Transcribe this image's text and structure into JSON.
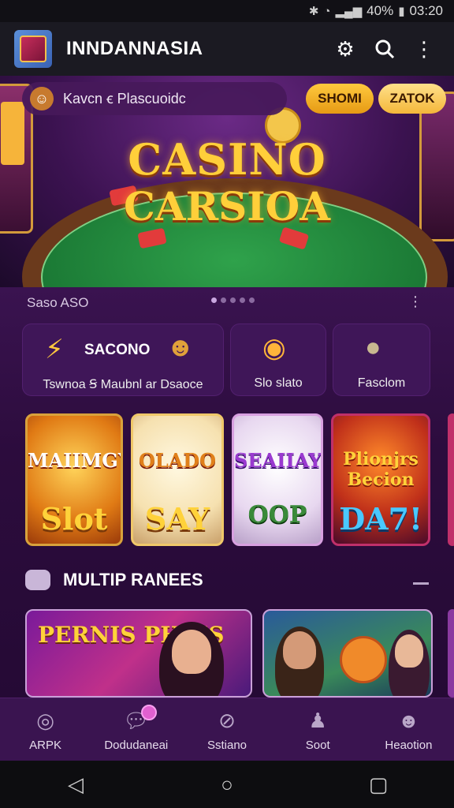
{
  "status_bar": {
    "battery": "40%",
    "time": "03:20"
  },
  "app_bar": {
    "title": "INNDANNASIA"
  },
  "hero": {
    "promo_text": "Kavcn ꞓ Plascuoidc",
    "pill_1": "SHOMI",
    "pill_2": "ZATOK",
    "title_1": "CASINO",
    "title_2": "CARSIOA"
  },
  "section": {
    "title": "Saso ASO",
    "more": "⋮"
  },
  "categories": [
    {
      "title": "SACONO",
      "label": "Tswnoa Ꞩ Maubnl ar Dsaoce"
    },
    {
      "label": "Slo slato"
    },
    {
      "label": "Fasclom"
    }
  ],
  "games": [
    {
      "title": "MAIIMGY",
      "subtitle": "Slot"
    },
    {
      "title": "OLADO",
      "subtitle": "SAY"
    },
    {
      "title": "SEAIIAY",
      "subtitle": "OOP"
    },
    {
      "title": "Plionjrs Becion",
      "subtitle": "DA7!"
    }
  ],
  "multiplayer": {
    "title": "MULTIP RANEES",
    "banner_1_title": "PERNIS PHIES"
  },
  "bottom_nav": [
    {
      "label": "ARPK",
      "icon": "home-icon"
    },
    {
      "label": "Dodudaneai",
      "icon": "chat-icon"
    },
    {
      "label": "Sstiano",
      "icon": "compass-icon"
    },
    {
      "label": "Soot",
      "icon": "person-icon"
    },
    {
      "label": "Heaotion",
      "icon": "account-icon"
    }
  ],
  "colors": {
    "accent": "#f4b73a",
    "background": "#2c0c3d",
    "nav": "#3a1450"
  }
}
